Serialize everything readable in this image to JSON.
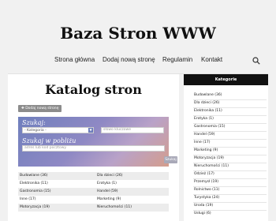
{
  "site": {
    "title": "Baza Stron WWW"
  },
  "nav": {
    "items": [
      "Strona główna",
      "Dodaj nową stronę",
      "Regulamin",
      "Kontakt"
    ],
    "search_icon": "search-icon"
  },
  "main": {
    "heading": "Katalog stron",
    "add_button": "✚ Dodaj nową stronę",
    "search": {
      "title": "Szukaj:",
      "category_value": "- Kategoria -",
      "keyword_placeholder": "słowo kluczowe",
      "nearby_title": "Szukaj w pobliżu",
      "address_placeholder": "adres lub kod pocztowy",
      "submit_label": "Szukaj"
    },
    "categories": [
      [
        "Budowlane (36)",
        "Dla dzieci (26)"
      ],
      [
        "Elektronika (11)",
        "Erotyka (1)"
      ],
      [
        "Gastronomia (15)",
        "Handel (59)"
      ],
      [
        "Inne (17)",
        "Marketing (9)"
      ],
      [
        "Motoryzacja (19)",
        "Nieruchomości (11)"
      ]
    ]
  },
  "sidebar": {
    "header": "Kategorie",
    "items": [
      "Budowlane (36)",
      "Dla dzieci (26)",
      "Elektronika (11)",
      "Erotyka (1)",
      "Gastronomia (15)",
      "Handel (59)",
      "Inne (17)",
      "Marketing (9)",
      "Motoryzacja (19)",
      "Nieruchomości (11)",
      "Odzież (17)",
      "Przemysł (19)",
      "Rolnictwo (11)",
      "Turystyka (24)",
      "Uroda (19)",
      "Usługi (6)"
    ]
  }
}
